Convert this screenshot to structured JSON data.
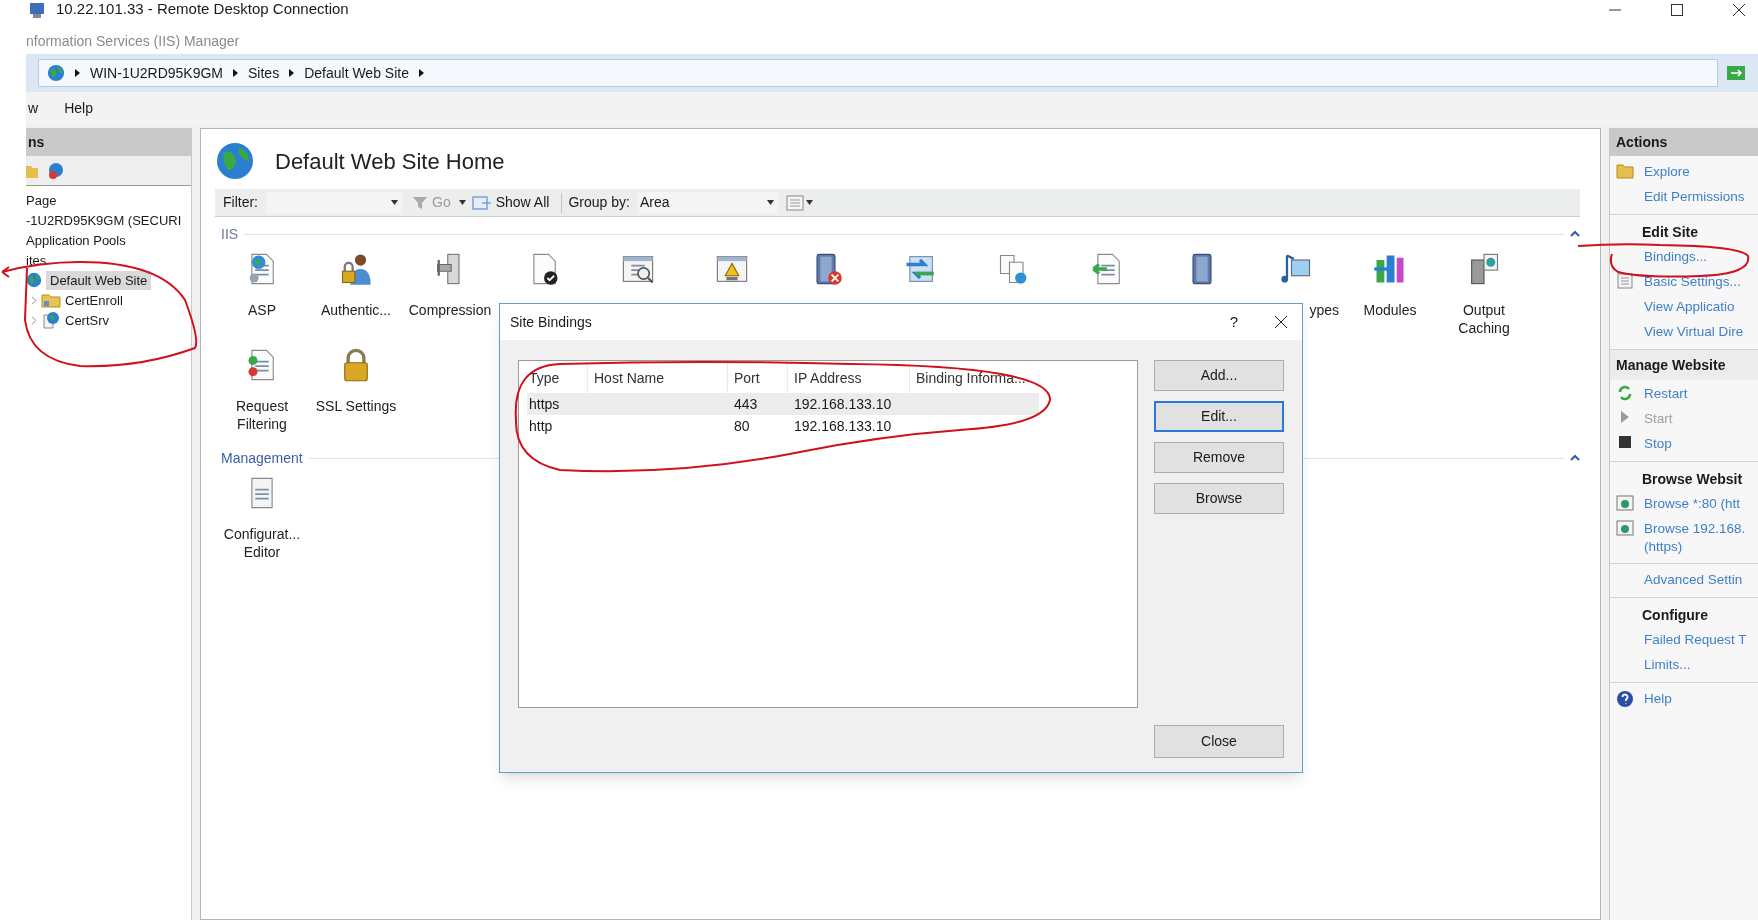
{
  "window": {
    "title": "10.22.101.33 - Remote Desktop Connection"
  },
  "app_title": "nformation Services (IIS) Manager",
  "breadcrumb": [
    "WIN-1U2RD95K9GM",
    "Sites",
    "Default Web Site"
  ],
  "menu": [
    "w",
    "Help"
  ],
  "connections": {
    "title": "ns",
    "tree": [
      {
        "label": "Page",
        "selected": false
      },
      {
        "label": "-1U2RD95K9GM (SECURI",
        "selected": false,
        "children": [
          {
            "label": "Application Pools",
            "selected": false
          },
          {
            "label": "ites",
            "selected": false,
            "children": [
              {
                "label": "Default Web Site",
                "selected": true,
                "children": [
                  {
                    "label": "CertEnroll",
                    "selected": false,
                    "expanded": false
                  },
                  {
                    "label": "CertSrv",
                    "selected": false,
                    "expanded": false
                  }
                ]
              }
            ]
          }
        ]
      }
    ]
  },
  "page": {
    "title": "Default Web Site Home",
    "filter": {
      "label": "Filter:",
      "go": "Go",
      "show_all": "Show All",
      "group_by_label": "Group by:",
      "group_by_value": "Area"
    },
    "groups": [
      {
        "name": "IIS",
        "expanded": true,
        "features": [
          {
            "kind": "labeled",
            "label": "ASP"
          },
          {
            "kind": "labeled",
            "label": "Authentic..."
          },
          {
            "kind": "labeled",
            "label": "Compression"
          },
          {
            "kind": "icon"
          },
          {
            "kind": "icon"
          },
          {
            "kind": "icon"
          },
          {
            "kind": "icon"
          },
          {
            "kind": "icon"
          },
          {
            "kind": "icon"
          },
          {
            "kind": "icon"
          },
          {
            "kind": "icon"
          },
          {
            "kind": "labeled",
            "label": "ypes"
          },
          {
            "kind": "labeled",
            "label": "Modules"
          },
          {
            "kind": "labeled",
            "label": "Output Caching"
          },
          {
            "kind": "labeled",
            "label": "Request Filtering"
          },
          {
            "kind": "labeled",
            "label": "SSL Settings"
          }
        ]
      },
      {
        "name": "Management",
        "expanded": true,
        "features": [
          {
            "kind": "labeled",
            "label": "Configurat... Editor"
          }
        ]
      }
    ]
  },
  "dialog": {
    "title": "Site Bindings",
    "help": "?",
    "columns": [
      "Type",
      "Host Name",
      "Port",
      "IP Address",
      "Binding Informa..."
    ],
    "rows": [
      {
        "cells": [
          "https",
          "",
          "443",
          "192.168.133.10",
          ""
        ],
        "selected": true
      },
      {
        "cells": [
          "http",
          "",
          "80",
          "192.168.133.10",
          ""
        ],
        "selected": false
      }
    ],
    "buttons": [
      {
        "label": "Add...",
        "focused": false
      },
      {
        "label": "Edit...",
        "focused": true
      },
      {
        "label": "Remove",
        "focused": false
      },
      {
        "label": "Browse",
        "focused": false
      }
    ],
    "close": "Close"
  },
  "actions": {
    "title": "Actions",
    "sections": [
      {
        "kind": "task",
        "items": [
          {
            "label": "Explore",
            "disabled": false
          },
          {
            "label": "Edit Permissions",
            "disabled": false
          }
        ]
      },
      {
        "kind": "task",
        "heading": "Edit Site",
        "items": [
          {
            "label": "Bindings...",
            "disabled": false
          },
          {
            "label": "Basic Settings...",
            "disabled": false
          },
          {
            "label": "View Applicatio",
            "disabled": false
          },
          {
            "label": "View Virtual Dire",
            "disabled": false
          }
        ]
      },
      {
        "kind": "panel",
        "heading": "Manage Website",
        "items": [
          {
            "label": "Restart",
            "disabled": false
          },
          {
            "label": "Start",
            "disabled": true
          },
          {
            "label": "Stop",
            "disabled": false
          }
        ]
      },
      {
        "kind": "task",
        "heading": "Browse Websit",
        "items": [
          {
            "label": "Browse *:80 (htt",
            "disabled": false
          },
          {
            "label": "Browse 192.168. (https)",
            "disabled": false
          }
        ]
      },
      {
        "kind": "task",
        "items": [
          {
            "label": "Advanced Settin",
            "disabled": false
          }
        ]
      },
      {
        "kind": "task",
        "heading": "Configure",
        "items": [
          {
            "label": "Failed Request T",
            "disabled": false
          },
          {
            "label": "Limits...",
            "disabled": false
          }
        ]
      },
      {
        "kind": "task",
        "items": [
          {
            "label": "Help",
            "disabled": false
          }
        ]
      }
    ]
  }
}
